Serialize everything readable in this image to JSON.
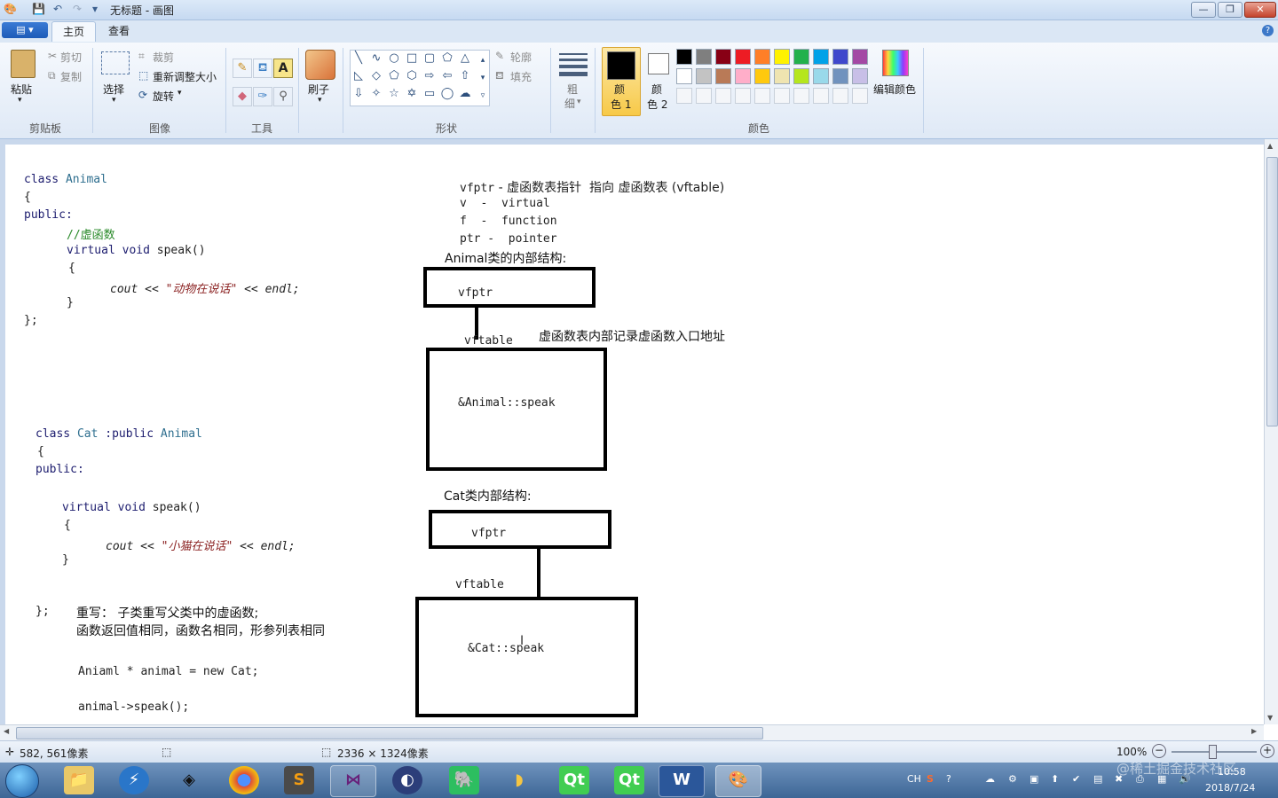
{
  "window": {
    "title": "无标题 - 画图",
    "controls": {
      "minimize": "—",
      "maximize": "❐",
      "close": "✕"
    }
  },
  "tabs": {
    "file": "▤ ▾",
    "home": "主页",
    "view": "查看"
  },
  "ribbon": {
    "clipboard": {
      "label": "剪贴板",
      "paste": "粘贴",
      "cut": "剪切",
      "copy": "复制"
    },
    "image": {
      "label": "图像",
      "select": "选择",
      "crop": "裁剪",
      "resize": "重新调整大小",
      "rotate": "旋转"
    },
    "tools": {
      "label": "工具",
      "brush": "刷子"
    },
    "shapes": {
      "label": "形状",
      "outline": "轮廓",
      "fill": "填充"
    },
    "size": {
      "label1": "粗",
      "label2": "细"
    },
    "colors": {
      "label": "颜色",
      "color1_a": "颜",
      "color1_b": "色 1",
      "color2_a": "颜",
      "color2_b": "色 2",
      "edit": "编辑颜色",
      "palette_row1": [
        "#000000",
        "#7f7f7f",
        "#880015",
        "#ed1c24",
        "#ff7f27",
        "#fff200",
        "#22b14c",
        "#00a2e8",
        "#3f48cc",
        "#a349a4"
      ],
      "palette_row2": [
        "#ffffff",
        "#c3c3c3",
        "#b97a57",
        "#ffaec9",
        "#ffc90e",
        "#efe4b0",
        "#b5e61d",
        "#99d9ea",
        "#7092be",
        "#c8bfe7"
      ]
    }
  },
  "canvas": {
    "animal": {
      "line1a": "class ",
      "line1b": "Animal",
      "line2": "{",
      "line3": "public:",
      "line4": "//虚函数",
      "line5a": "virtual void ",
      "line5b": "speak()",
      "line6": "{",
      "line7a": "cout",
      "line7b": " << ",
      "line7c": "\"动物在说话\"",
      "line7d": " << ",
      "line7e": "endl;",
      "line8": "}",
      "line9": "};"
    },
    "cat": {
      "line1a": "class ",
      "line1b": "Cat",
      "line1c": " :public ",
      "line1d": "Animal",
      "line2": "{",
      "line3": "public:",
      "line4a": "virtual void ",
      "line4b": "speak()",
      "line5": "{",
      "line6a": "cout",
      "line6b": " << ",
      "line6c": "\"小猫在说话\"",
      "line6d": " << ",
      "line6e": "endl;",
      "line7": "}",
      "line8": "};"
    },
    "notes": {
      "override1": "重写：  子类重写父类中的虚函数;",
      "override2": "函数返回值相同，函数名相同，形参列表相同",
      "code1": "Aniaml * animal = new Cat;",
      "code2": "animal->speak();"
    },
    "legend": {
      "l1a": "vfptr",
      "l1b": " - 虚函数表指针  指向 虚函数表 (vftable)",
      "l2": "v  -  virtual",
      "l3": "f  -  function",
      "l4": "ptr -  pointer",
      "animal_struct": "Animal类的内部结构:",
      "vftable_note": "虚函数表内部记录虚函数入口地址",
      "cat_struct": "Cat类内部结构:"
    },
    "diagram": {
      "animal_vfptr": "vfptr",
      "animal_vftable": "vftable",
      "animal_entry": "&Animal::speak",
      "cat_vfptr": "vfptr",
      "cat_vftable": "vftable",
      "cat_entry": "&Cat::speak"
    }
  },
  "statusbar": {
    "cursor_pos": "582, 561像素",
    "canvas_size": "2336 × 1324像素",
    "zoom": "100%"
  },
  "taskbar": {
    "apps": [
      "文件夹",
      "Thunder",
      "Unity",
      "Chrome",
      "Sublime",
      "Visual Studio",
      "Eclipse",
      "Evernote",
      "SQL",
      "Qt",
      "Qt Designer",
      "Word",
      "画图"
    ],
    "ime": "CH",
    "time": "10:58",
    "date": "2018/7/24",
    "watermark": "@稀土掘金技术社区"
  }
}
